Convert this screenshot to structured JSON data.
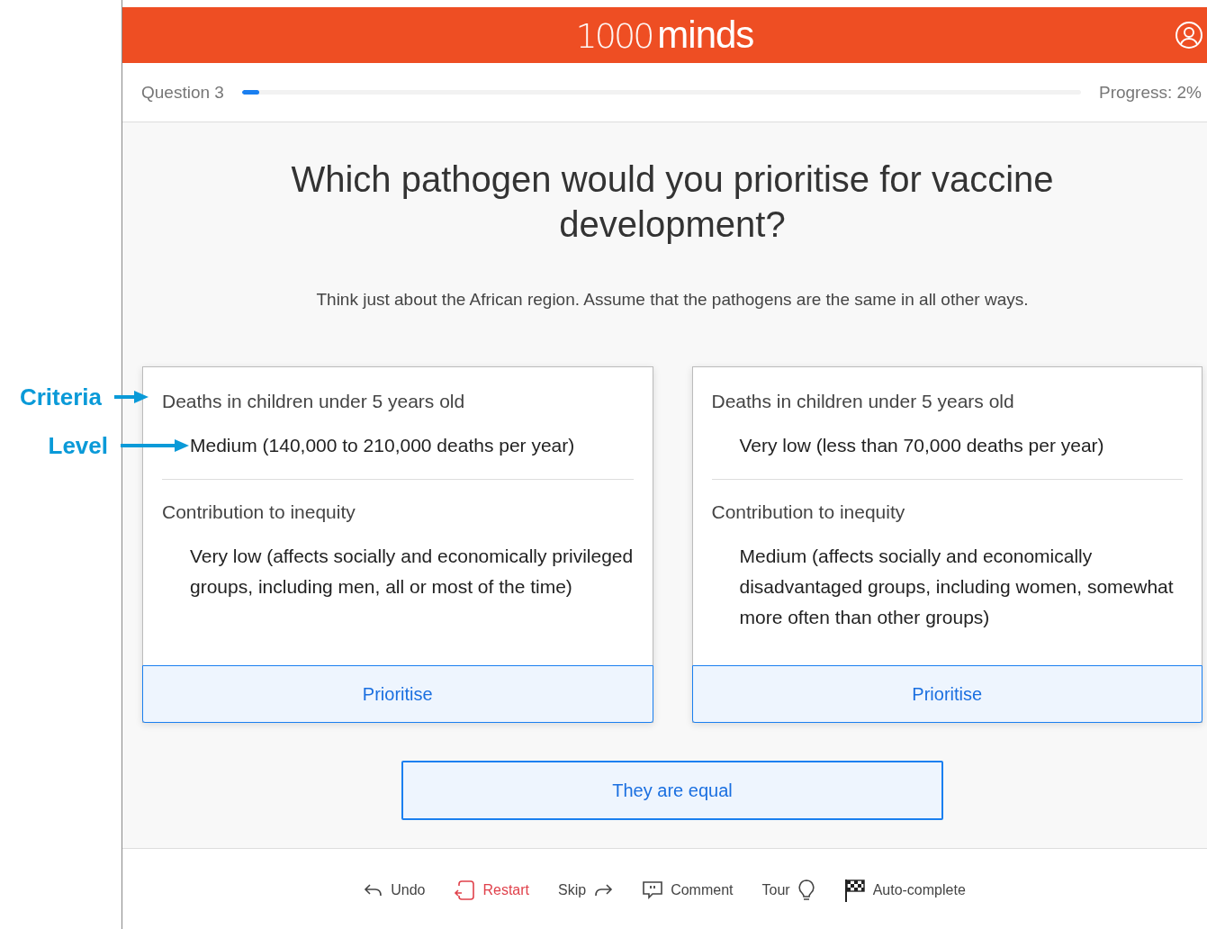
{
  "header": {
    "logo_light": "1000",
    "logo_bold": "minds"
  },
  "progress": {
    "question": "Question 3",
    "level": 0.02,
    "reading": "Progress: 2%"
  },
  "question": {
    "title": "Which pathogen would you prioritise for vaccine development?",
    "instruction": "Think just about the African region. Assume that the pathogens are the same in all other ways."
  },
  "options": [
    {
      "attributes": [
        {
          "criterion": "Deaths in children under 5 years old",
          "level": "Medium (140,000 to 210,000 deaths per year)"
        },
        {
          "criterion": "Contribution to inequity",
          "level": "Very low (affects socially and economically privileged groups, including men, all or most of the time)"
        }
      ],
      "button": "Prioritise"
    },
    {
      "attributes": [
        {
          "criterion": "Deaths in children under 5 years old",
          "level": "Very low (less than 70,000 deaths per year)"
        },
        {
          "criterion": "Contribution to inequity",
          "level": "Medium (affects socially and economically disadvantaged groups, including women, somewhat more often than other groups)"
        }
      ],
      "button": "Prioritise"
    }
  ],
  "equal_button": "They are equal",
  "actions": [
    {
      "kind": "undo",
      "label": "Undo"
    },
    {
      "kind": "restart",
      "label": "Restart"
    },
    {
      "kind": "skip",
      "label": "Skip"
    },
    {
      "kind": "comment",
      "label": "Comment"
    },
    {
      "kind": "tour",
      "label": "Tour"
    },
    {
      "kind": "autocomplete",
      "label": "Auto-complete"
    }
  ],
  "annotations": [
    {
      "label": "Criteria"
    },
    {
      "label": "Level"
    }
  ]
}
